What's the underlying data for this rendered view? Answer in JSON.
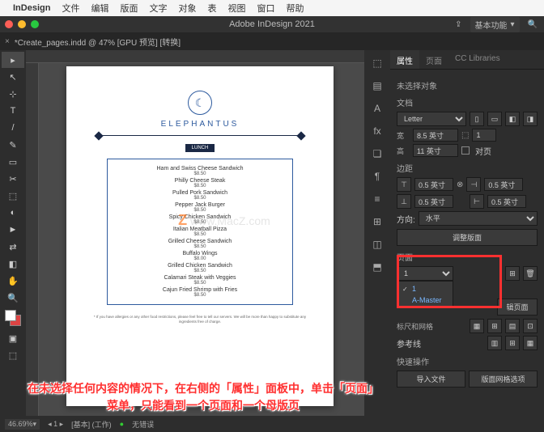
{
  "menubar": {
    "app": "InDesign",
    "items": [
      "文件",
      "编辑",
      "版面",
      "文字",
      "对象",
      "表",
      "视图",
      "窗口",
      "帮助"
    ]
  },
  "titlebar": {
    "title": "Adobe InDesign 2021",
    "workspace": "基本功能"
  },
  "document": {
    "tab": "*Create_pages.indd @ 47% [GPU 预览] [转换]"
  },
  "tools": [
    "▸",
    "↖",
    "⊹",
    "T",
    "/",
    "✎",
    "▭",
    "✂",
    "⬚",
    "◐",
    "►",
    "⇄",
    "◧",
    "✋",
    "🔍"
  ],
  "strip_icons": [
    "⬚",
    "▤",
    "A",
    "fx",
    "❏",
    "¶",
    "≡",
    "⊞",
    "◫",
    "⬒"
  ],
  "page": {
    "brand": "ELEPHANTUS",
    "section": "LUNCH",
    "items": [
      {
        "name": "Ham and Swiss Cheese Sandwich",
        "price": "$8.50"
      },
      {
        "name": "Philly Cheese Steak",
        "price": "$8.50"
      },
      {
        "name": "Pulled Pork Sandwich",
        "price": "$8.50"
      },
      {
        "name": "Pepper Jack Burger",
        "price": "$8.50"
      },
      {
        "name": "Spicy Chicken Sandwich",
        "price": "$8.50"
      },
      {
        "name": "Italian Meatball Pizza",
        "price": "$8.50"
      },
      {
        "name": "Grilled Cheese Sandwich",
        "price": "$8.50"
      },
      {
        "name": "Buffalo Wings",
        "price": "$8.00"
      },
      {
        "name": "Grilled Chicken Sandwich",
        "price": "$8.50"
      },
      {
        "name": "Calamari Steak with Veggies",
        "price": "$8.50"
      },
      {
        "name": "Cajun Fried Shrimp with Fries",
        "price": "$8.50"
      }
    ],
    "disclaimer": "* If you have allergies or any other food restrictions, please feel free to tell our servers. We will be more than happy to substitute any ingredients free of charge."
  },
  "watermark": {
    "z": "Z",
    "text": "www.MacZ.com"
  },
  "panel": {
    "tabs": [
      "属性",
      "页面",
      "CC Libraries"
    ],
    "no_selection": "未选择对象",
    "doc_label": "文档",
    "preset": "Letter",
    "width_label": "宽",
    "width": "8.5 英寸",
    "height_label": "高",
    "height": "11 英寸",
    "pages_count_label": "",
    "pages_count": "1",
    "facing": "对页",
    "margins_label": "边距",
    "margin_val": "0.5 英寸",
    "direction_label": "方向:",
    "direction": "水平",
    "adjust_layout": "调整版面",
    "pages_section": "页面",
    "page_selector": "1",
    "popup_items": [
      "1",
      "A-Master"
    ],
    "edit_spread": "辑页面",
    "ruler_guides": "参考线",
    "quick_actions": "快速操作",
    "import_file": "导入文件",
    "grid_options": "版面网格选项"
  },
  "status": {
    "zoom": "46.69%",
    "page": "1",
    "basic": "[基本] (工作)",
    "errors": "无错误"
  },
  "annotation": "在未选择任何内容的情况下，在右侧的「属性」面板中，单击「页面」菜单，只能看到一个页面和一个母版页"
}
